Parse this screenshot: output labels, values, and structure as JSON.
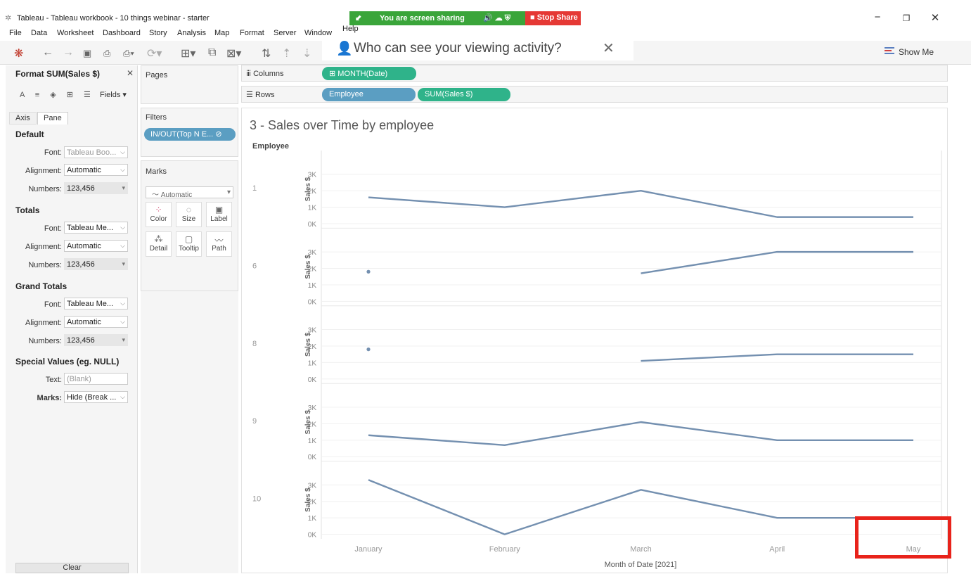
{
  "window": {
    "title": "Tableau - Tableau workbook - 10 things webinar - starter",
    "minimize": "−",
    "maximize": "❐",
    "close": "✕"
  },
  "screen_share": {
    "status": "You are screen sharing",
    "stop_label": "Stop Share"
  },
  "menu": [
    "File",
    "Data",
    "Worksheet",
    "Dashboard",
    "Story",
    "Analysis",
    "Map",
    "Format",
    "Server",
    "Window",
    "Help"
  ],
  "popup": {
    "text": "Who can see your viewing activity?"
  },
  "toolbar": {
    "show_me": "Show Me"
  },
  "format_pane": {
    "title": "Format SUM(Sales $)",
    "fields_label": "Fields",
    "tabs": [
      "Axis",
      "Pane"
    ],
    "sections": [
      {
        "title": "Default",
        "rows": [
          {
            "label": "Font:",
            "value": "Tableau Boo..."
          },
          {
            "label": "Alignment:",
            "value": "Automatic"
          },
          {
            "label": "Numbers:",
            "value": "123,456"
          }
        ]
      },
      {
        "title": "Totals",
        "rows": [
          {
            "label": "Font:",
            "value": "Tableau Me..."
          },
          {
            "label": "Alignment:",
            "value": "Automatic"
          },
          {
            "label": "Numbers:",
            "value": "123,456"
          }
        ]
      },
      {
        "title": "Grand Totals",
        "rows": [
          {
            "label": "Font:",
            "value": "Tableau Me..."
          },
          {
            "label": "Alignment:",
            "value": "Automatic"
          },
          {
            "label": "Numbers:",
            "value": "123,456"
          }
        ]
      },
      {
        "title": "Special Values (eg. NULL)",
        "rows": [
          {
            "label": "Text:",
            "value": "(Blank)"
          },
          {
            "label": "Marks:",
            "value": "Hide (Break ..."
          }
        ]
      }
    ],
    "clear_label": "Clear"
  },
  "cards": {
    "pages": "Pages",
    "filters": "Filters",
    "filter_pill": "IN/OUT(Top N E...",
    "marks": "Marks",
    "marks_type": "Automatic",
    "mark_buttons": [
      "Color",
      "Size",
      "Label",
      "Detail",
      "Tooltip",
      "Path"
    ]
  },
  "shelves": {
    "columns_label": "Columns",
    "columns_pill": "MONTH(Date)",
    "rows_label": "Rows",
    "rows_pills": [
      "Employee",
      "SUM(Sales $)"
    ]
  },
  "viz": {
    "title": "3 - Sales over Time by employee",
    "row_header": "Employee"
  },
  "chart_data": {
    "type": "line",
    "title": "3 - Sales over Time by employee",
    "xlabel": "Month of Date [2021]",
    "ylabel": "Sales $",
    "categories": [
      "January",
      "February",
      "March",
      "April",
      "May"
    ],
    "y_ticks": [
      "3K",
      "2K",
      "1K",
      "0K"
    ],
    "ylim": [
      0,
      3500
    ],
    "line_color": "#7490b0",
    "grid": true,
    "series": [
      {
        "name": "1",
        "values": [
          1600,
          1000,
          2000,
          400,
          400
        ]
      },
      {
        "name": "6",
        "values": [
          1800,
          null,
          1700,
          3000,
          3000
        ]
      },
      {
        "name": "8",
        "values": [
          1800,
          null,
          1100,
          1500,
          1500
        ]
      },
      {
        "name": "9",
        "values": [
          1300,
          700,
          2100,
          1000,
          1000
        ]
      },
      {
        "name": "10",
        "values": [
          3300,
          0,
          2700,
          1000,
          1000
        ]
      }
    ]
  }
}
